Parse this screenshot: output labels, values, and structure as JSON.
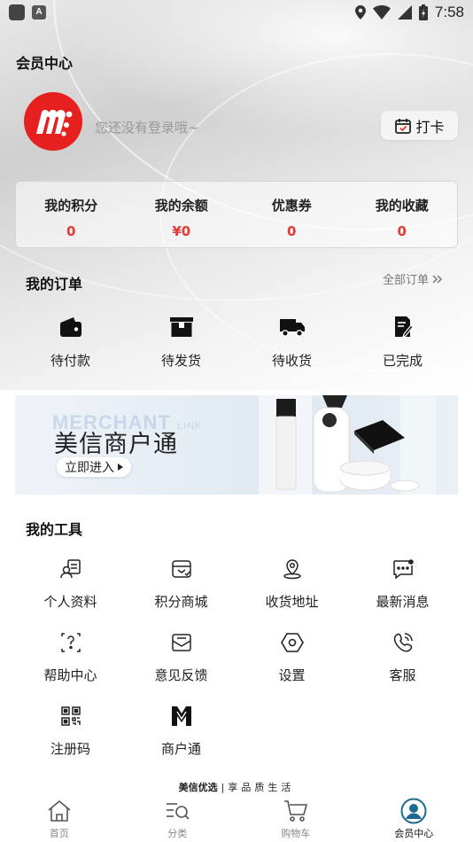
{
  "status_bar": {
    "time": "7:58",
    "icons": [
      "notification-square-icon",
      "a-badge-icon",
      "location-icon",
      "wifi-icon",
      "signal-icon",
      "battery-icon"
    ]
  },
  "header": {
    "title": "会员中心"
  },
  "profile": {
    "login_hint": "您还没有登录哦~",
    "checkin_label": "打卡"
  },
  "stats": [
    {
      "label": "我的积分",
      "value": "0"
    },
    {
      "label": "我的余额",
      "value": "¥0"
    },
    {
      "label": "优惠券",
      "value": "0"
    },
    {
      "label": "我的收藏",
      "value": "0"
    }
  ],
  "orders": {
    "title": "我的订单",
    "all_label": "全部订单",
    "items": [
      {
        "label": "待付款",
        "icon": "wallet-icon"
      },
      {
        "label": "待发货",
        "icon": "package-icon"
      },
      {
        "label": "待收货",
        "icon": "truck-icon"
      },
      {
        "label": "已完成",
        "icon": "document-check-icon"
      }
    ]
  },
  "banner": {
    "bg_text": "MERCHANT",
    "bg_text_small": "LINK",
    "title": "美信商户通",
    "button": "立即进入"
  },
  "tools": {
    "title": "我的工具",
    "items": [
      {
        "label": "个人资料",
        "icon": "profile-card-icon"
      },
      {
        "label": "积分商城",
        "icon": "points-store-icon"
      },
      {
        "label": "收货地址",
        "icon": "location-pin-icon"
      },
      {
        "label": "最新消息",
        "icon": "message-icon"
      },
      {
        "label": "帮助中心",
        "icon": "help-icon"
      },
      {
        "label": "意见反馈",
        "icon": "feedback-icon"
      },
      {
        "label": "设置",
        "icon": "settings-icon"
      },
      {
        "label": "客服",
        "icon": "customer-service-icon"
      },
      {
        "label": "注册码",
        "icon": "qr-code-icon"
      },
      {
        "label": "商户通",
        "icon": "merchant-logo-icon"
      }
    ]
  },
  "slogan": {
    "brand": "美信优选",
    "separator": "|",
    "text": "享品质生活"
  },
  "bottom_nav": [
    {
      "label": "首页",
      "icon": "home-icon"
    },
    {
      "label": "分类",
      "icon": "category-search-icon"
    },
    {
      "label": "购物车",
      "icon": "cart-icon"
    },
    {
      "label": "会员中心",
      "icon": "member-icon",
      "active": true
    }
  ],
  "colors": {
    "accent_red": "#e53935",
    "brand_red": "#e5201f"
  }
}
